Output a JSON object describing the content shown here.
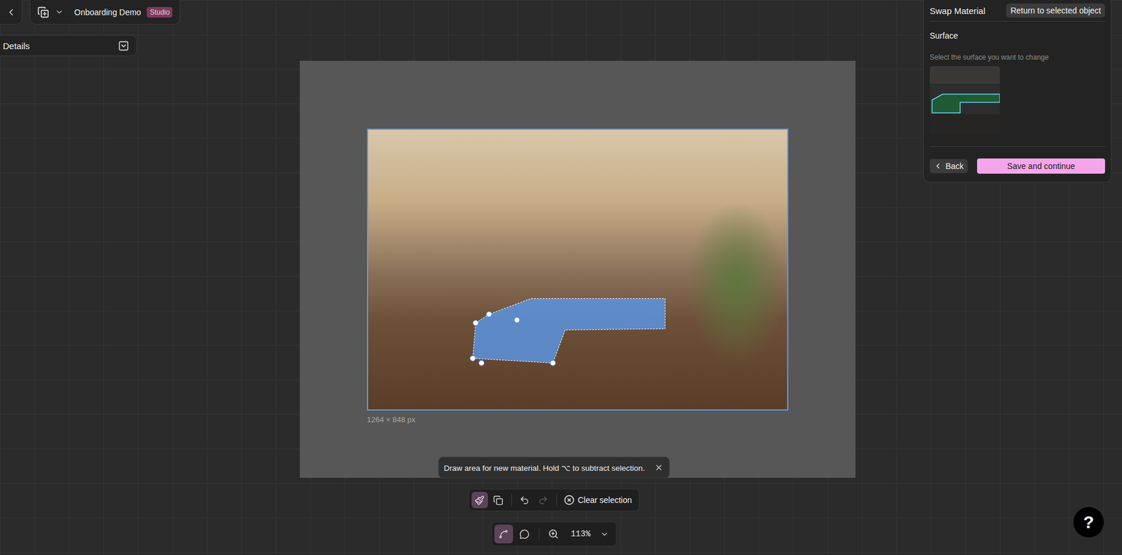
{
  "project": {
    "name": "Onboarding Demo",
    "badge": "Studio"
  },
  "details": {
    "title": "Details"
  },
  "canvas": {
    "image_size": "1264 × 848 px"
  },
  "hint": {
    "text": "Draw area for new material. Hold ⌥ to subtract selection."
  },
  "selection_tools": [
    {
      "kind": "brush",
      "selected": true
    },
    {
      "kind": "paste",
      "selected": false
    }
  ],
  "history": [
    {
      "kind": "undo",
      "disabled": false
    },
    {
      "kind": "redo",
      "disabled": true
    }
  ],
  "clear": "Clear selection",
  "view_tools": [
    {
      "kind": "pointer",
      "selected": true
    },
    {
      "kind": "comment",
      "selected": false
    }
  ],
  "zoom": "113%",
  "panel": {
    "title": "Swap Material",
    "return": "Return to selected object",
    "section": "Surface",
    "hint": "Select the surface you want to change",
    "surfaces": [
      {
        "selected": true
      }
    ],
    "back": "Back",
    "save": "Save and continue"
  },
  "help": "?"
}
